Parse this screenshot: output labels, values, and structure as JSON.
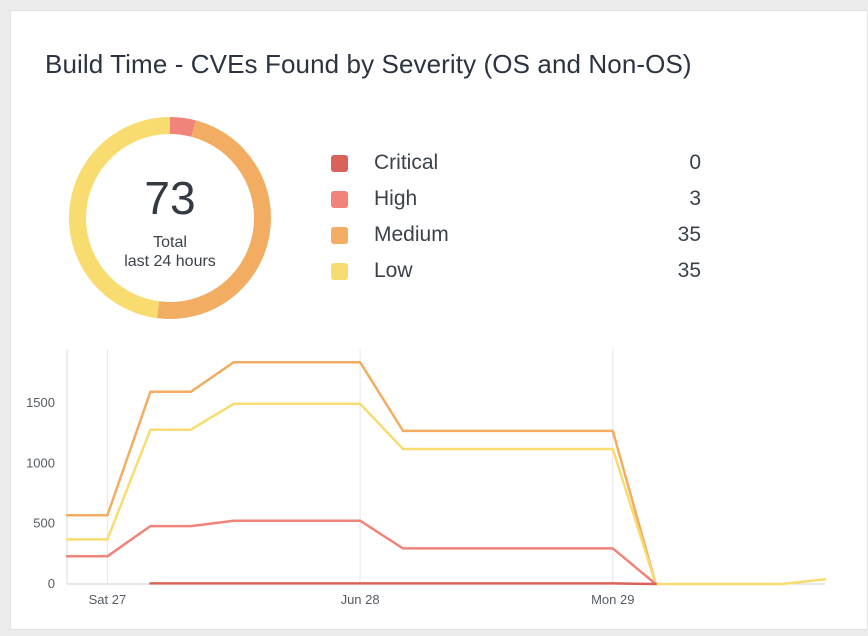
{
  "card": {
    "title": "Build Time - CVEs Found by Severity (OS and Non-OS)"
  },
  "summary": {
    "total": "73",
    "total_label": "Total",
    "period": "last 24 hours"
  },
  "legend": [
    {
      "label": "Critical",
      "value": "0",
      "color": "#d9625a"
    },
    {
      "label": "High",
      "value": "3",
      "color": "#f0837a"
    },
    {
      "label": "Medium",
      "value": "35",
      "color": "#f2ad62"
    },
    {
      "label": "Low",
      "value": "35",
      "color": "#f9dc70"
    }
  ],
  "chart_data": [
    {
      "type": "pie",
      "categories": [
        "Critical",
        "High",
        "Medium",
        "Low"
      ],
      "values": [
        0,
        3,
        35,
        35
      ],
      "colors": [
        "#d9625a",
        "#f0837a",
        "#f2ad62",
        "#f9dc70"
      ],
      "style": "donut"
    },
    {
      "type": "line",
      "x_ticks": [
        {
          "label": "Sat 27",
          "x": 27.0
        },
        {
          "label": "Jun 28",
          "x": 28.0
        },
        {
          "label": "Mon 29",
          "x": 29.0
        }
      ],
      "ylim": [
        0,
        1900
      ],
      "yticks": [
        0,
        500,
        1000,
        1500
      ],
      "grid": "vertical",
      "xlim": [
        26.84,
        29.84
      ],
      "series": [
        {
          "color": "#f2ad62",
          "x": [
            26.84,
            27.0,
            27.17,
            27.33,
            27.5,
            28.0,
            28.17,
            29.0,
            29.17
          ],
          "y": [
            570,
            570,
            1595,
            1595,
            1840,
            1840,
            1270,
            1270,
            0
          ]
        },
        {
          "color": "#f9dc70",
          "x": [
            26.84,
            27.0,
            27.17,
            27.33,
            27.5,
            28.0,
            28.17,
            29.0,
            29.17,
            29.67,
            29.84
          ],
          "y": [
            370,
            370,
            1280,
            1280,
            1495,
            1495,
            1120,
            1120,
            0,
            0,
            40
          ]
        },
        {
          "color": "#f0837a",
          "x": [
            26.84,
            27.0,
            27.17,
            27.33,
            27.5,
            28.0,
            28.17,
            29.0,
            29.17
          ],
          "y": [
            230,
            230,
            480,
            480,
            525,
            525,
            295,
            295,
            0
          ]
        },
        {
          "color": "#d9625a",
          "x": [
            27.17,
            29.0,
            29.17
          ],
          "y": [
            5,
            5,
            0
          ]
        }
      ]
    }
  ]
}
